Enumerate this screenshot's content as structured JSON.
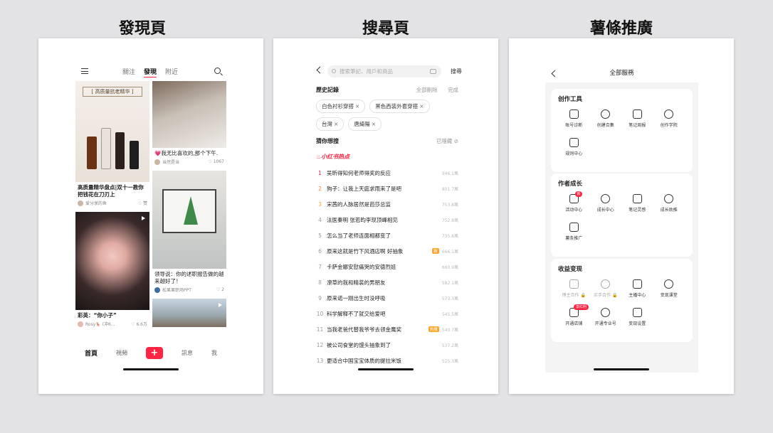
{
  "titles": {
    "discover": "發現頁",
    "search": "搜尋頁",
    "promo": "薯條推廣"
  },
  "discover": {
    "tabs": [
      "關注",
      "發現",
      "附近"
    ],
    "notes_left": [
      {
        "title": "高质量精华盘点|双十一教你把钱花在刀刃上",
        "author": "爱分享的鱼",
        "likes": "赞",
        "banner": "[ 高质量抗老精华 ]"
      },
      {
        "title": "彩英：“你小子”",
        "author": "Rosy🦌 (冲6...",
        "likes": "6.6万"
      }
    ],
    "notes_right": [
      {
        "title": "💗我无比喜欢的,那个下午.",
        "author": "当然是当",
        "likes": "1067"
      },
      {
        "title": "领导说：你的述职报告做的越来越好了！",
        "author": "松果果职场PPT",
        "likes": "2"
      }
    ],
    "nav": [
      "首頁",
      "視頻",
      "+",
      "訊息",
      "我"
    ]
  },
  "search": {
    "placeholder": "搜索筆記、用戶和商品",
    "go": "搜尋",
    "history_label": "歷史記錄",
    "delete_all": "全部刪除",
    "done": "完成",
    "history": [
      "白色衬衫穿搭",
      "黑色西装外套穿搭",
      "台灣",
      "唐綺陽"
    ],
    "guess_label": "猜你想搜",
    "hidden": "已隱藏",
    "hot_brand": "小红书热点",
    "hot": [
      {
        "rank": "1",
        "text": "吴昕得知何老师得奖的反应",
        "count": "946.1萬",
        "badge": ""
      },
      {
        "rank": "2",
        "text": "狗子：让我上天庭求雨来了是吧",
        "count": "801.7萬",
        "badge": ""
      },
      {
        "rank": "3",
        "text": "宋茜的人脉居然是芭莎总监",
        "count": "753.8萬",
        "badge": ""
      },
      {
        "rank": "4",
        "text": "法医秦明 张若昀李现顶峰相见",
        "count": "752.8萬",
        "badge": ""
      },
      {
        "rank": "5",
        "text": "怎么当了老师连面相都变了",
        "count": "735.8萬",
        "badge": ""
      },
      {
        "rank": "6",
        "text": "原来这就是竹下风酒店啊 好抽象",
        "count": "666.1萬",
        "badge": "新"
      },
      {
        "rank": "7",
        "text": "卡萨金娜安慰痛哭的安德烈娃",
        "count": "660.9萬",
        "badge": ""
      },
      {
        "rank": "8",
        "text": "潦草的我和精装的男朋友",
        "count": "582.1萬",
        "badge": ""
      },
      {
        "rank": "9",
        "text": "原来诺一刚出生时没呼吸",
        "count": "573.3萬",
        "badge": ""
      },
      {
        "rank": "10",
        "text": "科学解释不了就交给爱吧",
        "count": "545.5萬",
        "badge": ""
      },
      {
        "rank": "11",
        "text": "当我老爸代替我爷爷去领金鹰奖",
        "count": "540.7萬",
        "badge": "热搜"
      },
      {
        "rank": "12",
        "text": "被公司食堂的馒头抽象到了",
        "count": "537.2萬",
        "badge": ""
      },
      {
        "rank": "13",
        "text": "更适合中国宝宝体质的提拉米饭",
        "count": "525.3萬",
        "badge": ""
      }
    ]
  },
  "services": {
    "header": "全部服務",
    "groups": [
      {
        "title": "创作工具",
        "items": [
          {
            "label": "账号诊断",
            "icon": "stethoscope-icon"
          },
          {
            "label": "创建合集",
            "icon": "collection-icon"
          },
          {
            "label": "笔记周报",
            "icon": "report-icon"
          },
          {
            "label": "创作学院",
            "icon": "academy-icon"
          },
          {
            "label": "规则中心",
            "icon": "rules-icon"
          }
        ]
      },
      {
        "title": "作者成长",
        "items": [
          {
            "label": "活动中心",
            "icon": "activity-icon",
            "dot": "新"
          },
          {
            "label": "成长中心",
            "icon": "growth-icon"
          },
          {
            "label": "笔记灵感",
            "icon": "inspiration-icon"
          },
          {
            "label": "成长助推",
            "icon": "boost-icon"
          },
          {
            "label": "薯条推广",
            "icon": "promo-icon"
          }
        ]
      },
      {
        "title": "收益变现",
        "items": [
          {
            "label": "博主合作 🔒",
            "icon": "cooperation-icon",
            "dim": true
          },
          {
            "label": "买手合作 🔒",
            "icon": "buyer-icon",
            "dim": true
          },
          {
            "label": "主播中心",
            "icon": "anchor-icon"
          },
          {
            "label": "变现课堂",
            "icon": "course-icon"
          },
          {
            "label": "开通店铺",
            "icon": "shop-icon",
            "tag": "享红利"
          },
          {
            "label": "开通专业号",
            "icon": "pro-icon"
          },
          {
            "label": "变现设置",
            "icon": "settings-icon"
          }
        ]
      }
    ]
  }
}
